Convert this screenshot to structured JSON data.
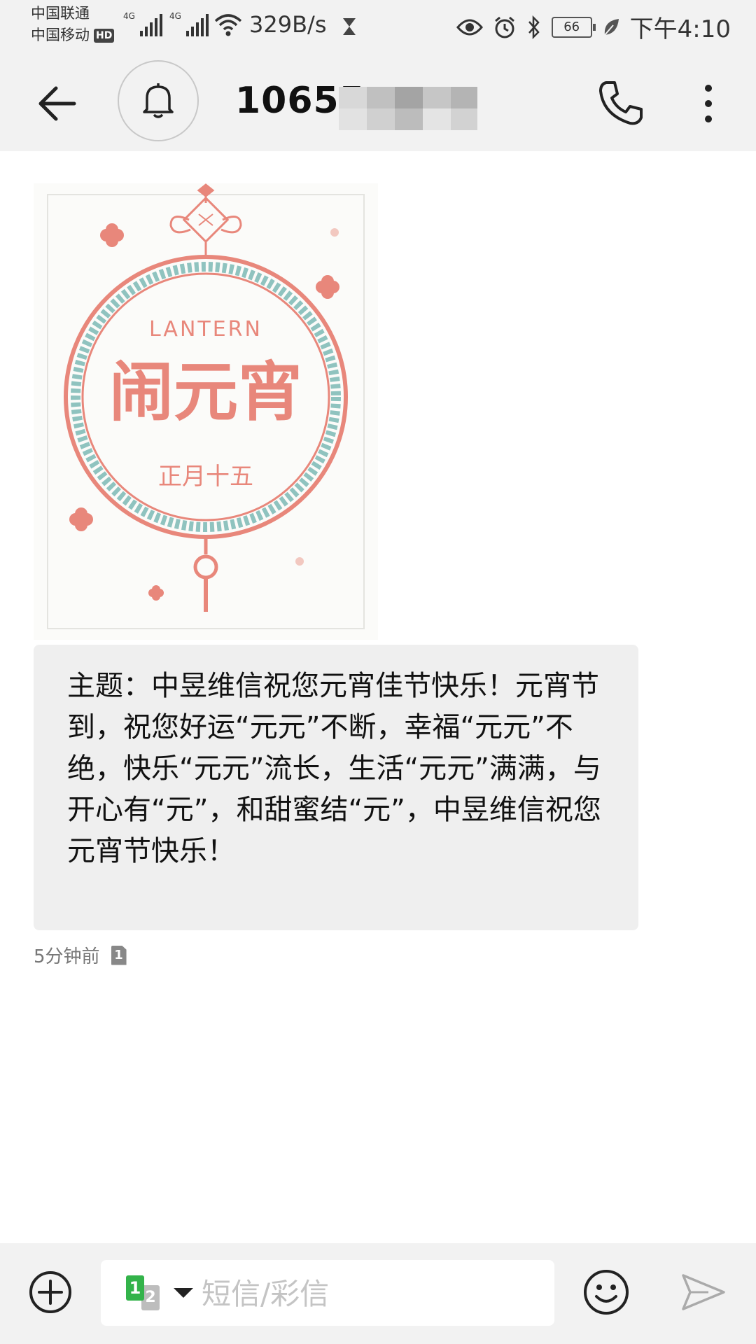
{
  "status_bar": {
    "carrier_1": "中国联通",
    "carrier_2": "中国移动",
    "hd_badge": "HD",
    "network_1": "4G",
    "network_2": "4G",
    "speed": "329B/s",
    "battery": "66",
    "time": "下午4:10"
  },
  "header": {
    "title": "10655"
  },
  "message": {
    "body": "主题：中昱维信祝您元宵佳节快乐！元宵节到，祝您好运“元元”不断，幸福“元元”不绝，快乐“元元”流长，生活“元元”满满，与开心有“元”，和甜蜜结“元”，中昱维信祝您元宵节快乐！",
    "image_text": {
      "top": "LANTERN",
      "main": "闹元宵",
      "bottom": "正月十五"
    },
    "time": "5分钟前",
    "sim_badge": "1"
  },
  "composer": {
    "sim_primary": "1",
    "sim_secondary": "2",
    "placeholder": "短信/彩信"
  },
  "colors": {
    "accent_red": "#e8877b",
    "teal": "#8fc3bf",
    "sim_green": "#33b34a"
  }
}
